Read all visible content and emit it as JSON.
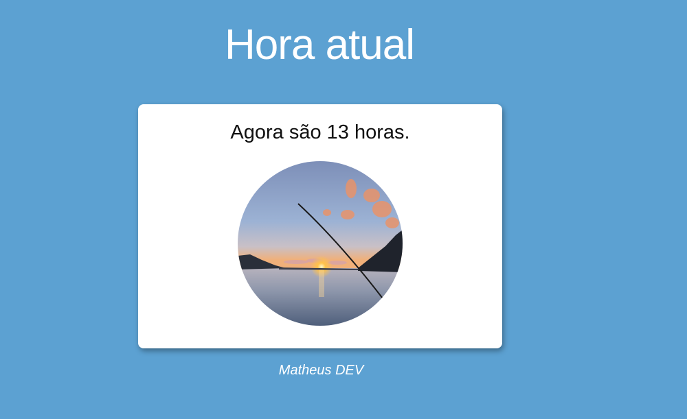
{
  "header": {
    "title": "Hora atual"
  },
  "card": {
    "message": "Agora são 13 horas.",
    "image_icon": "sunset-fishing-photo"
  },
  "footer": {
    "credit": "Matheus DEV"
  },
  "colors": {
    "background": "#5ca1d2",
    "card": "#ffffff",
    "title_text": "#ffffff",
    "body_text": "#111111"
  }
}
